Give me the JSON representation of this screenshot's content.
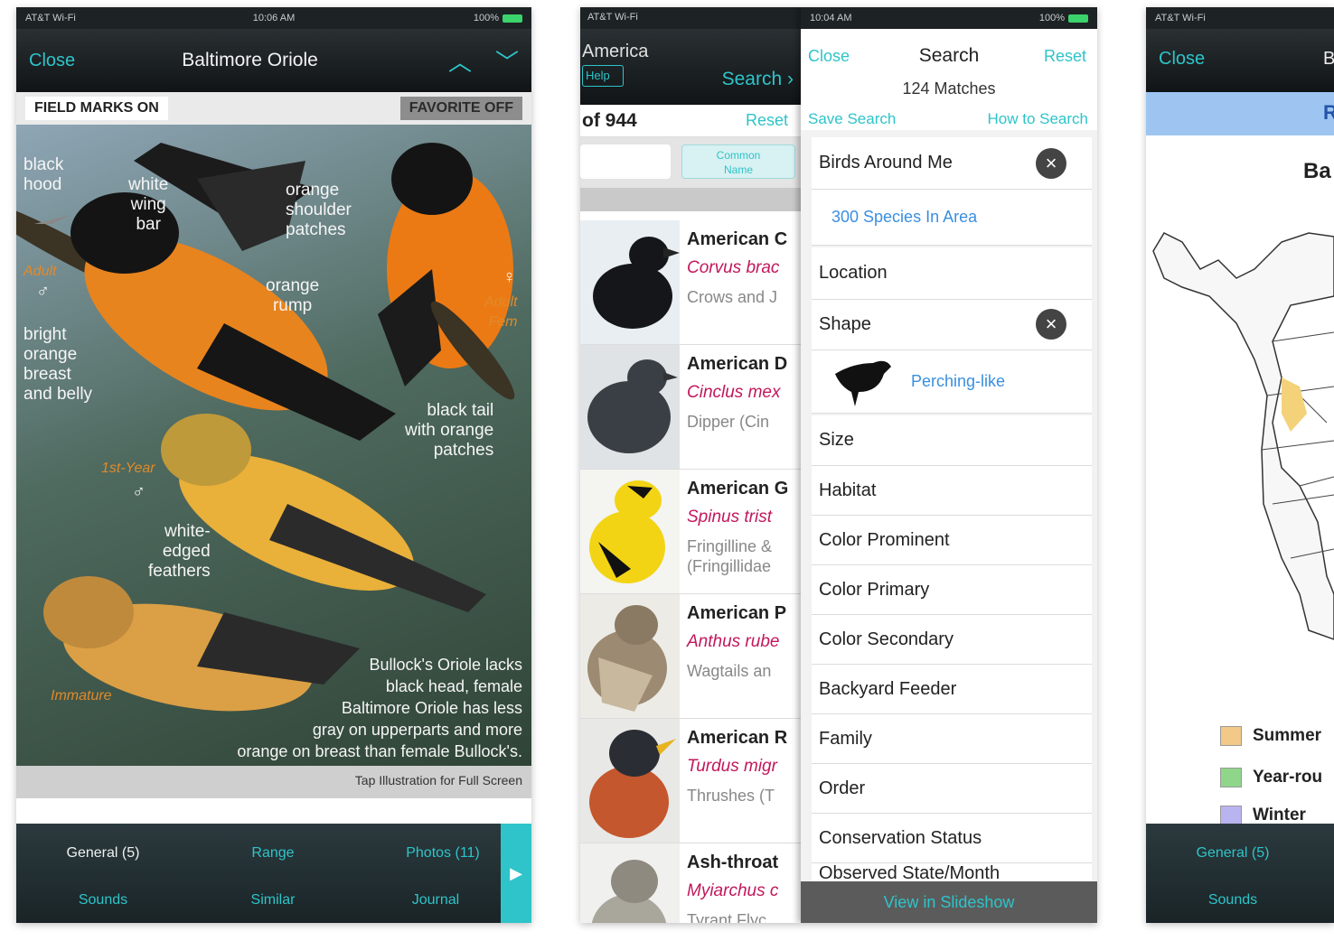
{
  "phone1": {
    "status": {
      "carrier": "AT&T Wi-Fi",
      "time": "10:06 AM",
      "battery": "100%"
    },
    "nav": {
      "close": "Close",
      "title": "Baltimore Oriole"
    },
    "toggles": {
      "field_marks": "FIELD MARKS ON",
      "favorite": "FAVORITE OFF"
    },
    "labels": {
      "black_hood": "black\nhood",
      "white_wing_bar": "white\nwing\nbar",
      "orange_shoulder": "orange\nshoulder\npatches",
      "orange_rump": "orange\nrump",
      "adult_male": "Adult",
      "male_symbol": "♂",
      "breast": "bright\norange\nbreast\nand belly",
      "female_symbol": "♀",
      "adult_female": "Adult\nFem",
      "black_tail": "black tail\nwith orange\npatches",
      "first_year": "1st-Year",
      "first_year_symbol": "♂",
      "white_edged": "white-\nedged\nfeathers",
      "immature": "Immature",
      "note": "Bullock's Oriole lacks\nblack head, female\nBaltimore Oriole has less\ngray on upperparts and more\norange on breast than female Bullock's."
    },
    "tap_hint": "Tap Illustration for Full Screen",
    "tabs": [
      "General (5)",
      "Range",
      "Photos (11)",
      "Sounds",
      "Similar",
      "Journal"
    ],
    "play_icon": "▶"
  },
  "phone2": {
    "status": {
      "carrier": "AT&T Wi-Fi",
      "time": "10:04 AM",
      "battery": "100%"
    },
    "nav": {
      "title": "America",
      "help": "Help",
      "search": "Search"
    },
    "count": "of 944",
    "reset": "Reset",
    "common_name": "Common\nName",
    "birds": [
      {
        "name": "American C",
        "sci": "Corvus brac",
        "family": "Crows and J"
      },
      {
        "name": "American D",
        "sci": "Cinclus mex",
        "family": "Dipper (Cin"
      },
      {
        "name": "American G",
        "sci": "Spinus trist",
        "family": "Fringilline &\n(Fringillidae"
      },
      {
        "name": "American P",
        "sci": "Anthus rube",
        "family": "Wagtails an"
      },
      {
        "name": "American R",
        "sci": "Turdus migr",
        "family": "Thrushes (T"
      },
      {
        "name": "Ash-throat",
        "sci": "Myiarchus c",
        "family": "Tyrant Flyc"
      }
    ],
    "panel": {
      "close": "Close",
      "title": "Search",
      "reset": "Reset",
      "matches": "124 Matches",
      "save": "Save Search",
      "how": "How to Search",
      "criteria": [
        "Birds Around Me",
        "300 Species In Area",
        "Location",
        "Shape",
        "Perching-like",
        "Size",
        "Habitat",
        "Color Prominent",
        "Color Primary",
        "Color Secondary",
        "Backyard Feeder",
        "Family",
        "Order",
        "Conservation Status",
        "Observed State/Month"
      ],
      "clear_icon": "×",
      "slideshow": "View in Slideshow"
    }
  },
  "phone3": {
    "status": {
      "carrier": "AT&T Wi-Fi"
    },
    "nav": {
      "close": "Close",
      "title": "B"
    },
    "blue_bar": "R",
    "map_title": "Ba",
    "legend": [
      {
        "label": "Summer",
        "color": "#f3c98a"
      },
      {
        "label": "Year-rou",
        "color": "#8fd68a"
      },
      {
        "label": "Winter",
        "color": "#b9b3f0"
      }
    ],
    "tabs": [
      "General (5)",
      "Sounds"
    ]
  }
}
